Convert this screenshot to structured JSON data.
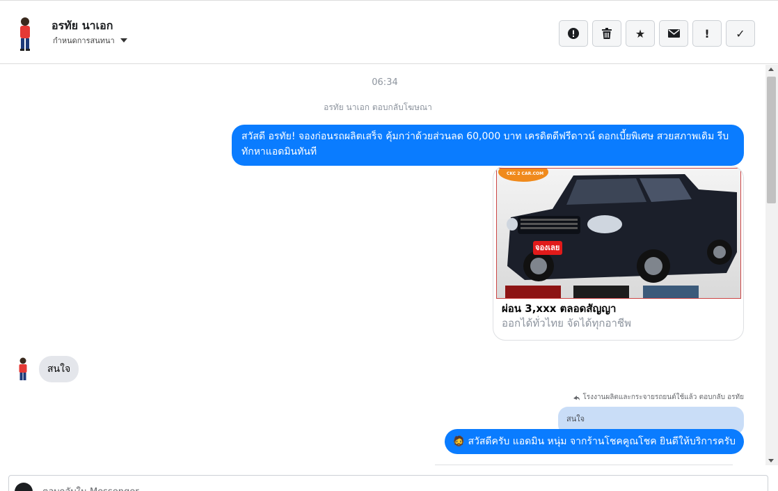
{
  "header": {
    "name": "อรทัย นาเอก",
    "subtitle": "กำหนดการสนทนา",
    "actions": [
      {
        "icon": "exclamation-circle-icon",
        "glyph": "!"
      },
      {
        "icon": "trash-icon",
        "glyph": ""
      },
      {
        "icon": "star-icon",
        "glyph": "★"
      },
      {
        "icon": "envelope-icon",
        "glyph": "✉"
      },
      {
        "icon": "exclamation-icon",
        "glyph": "!"
      },
      {
        "icon": "check-icon",
        "glyph": "✓"
      }
    ]
  },
  "thread": {
    "timestamp": "06:34",
    "reply_note": "อรทัย นาเอก ตอบกลับโฆษณา",
    "ad_message": "สวัสดี อรทัย! จองก่อนรถผลิตเสร็จ คุ้มกว่าด้วยส่วนลด 60,000 บาท เครดิตดีฟรีดาวน์ ดอกเบี้ยพิเศษ สวยสภาพเดิม รีบทักหาแอดมินทันที",
    "card": {
      "title": "ผ่อน 3,xxx ตลอดสัญญา",
      "description": "ออกได้ทั่วไทย จัดได้ทุกอาชีพ",
      "logo_text": "CKC 2 CAR.COM",
      "badge_text": "จองเลย"
    },
    "incoming_message": "สนใจ",
    "forward_note": "โรงงานผลิตและกระจายรถยนต์ใช้แล้ว ตอบกลับ อรทัย",
    "quoted_text": "สนใจ",
    "reply_message": "สวัสดีครับ แอดมิน หนุ่ม จากร้านโชคคูณโชค ยินดีให้บริการครับ",
    "reply_emoji": "🧔"
  },
  "composer": {
    "placeholder": "ตอบกลับใน Messenger"
  }
}
